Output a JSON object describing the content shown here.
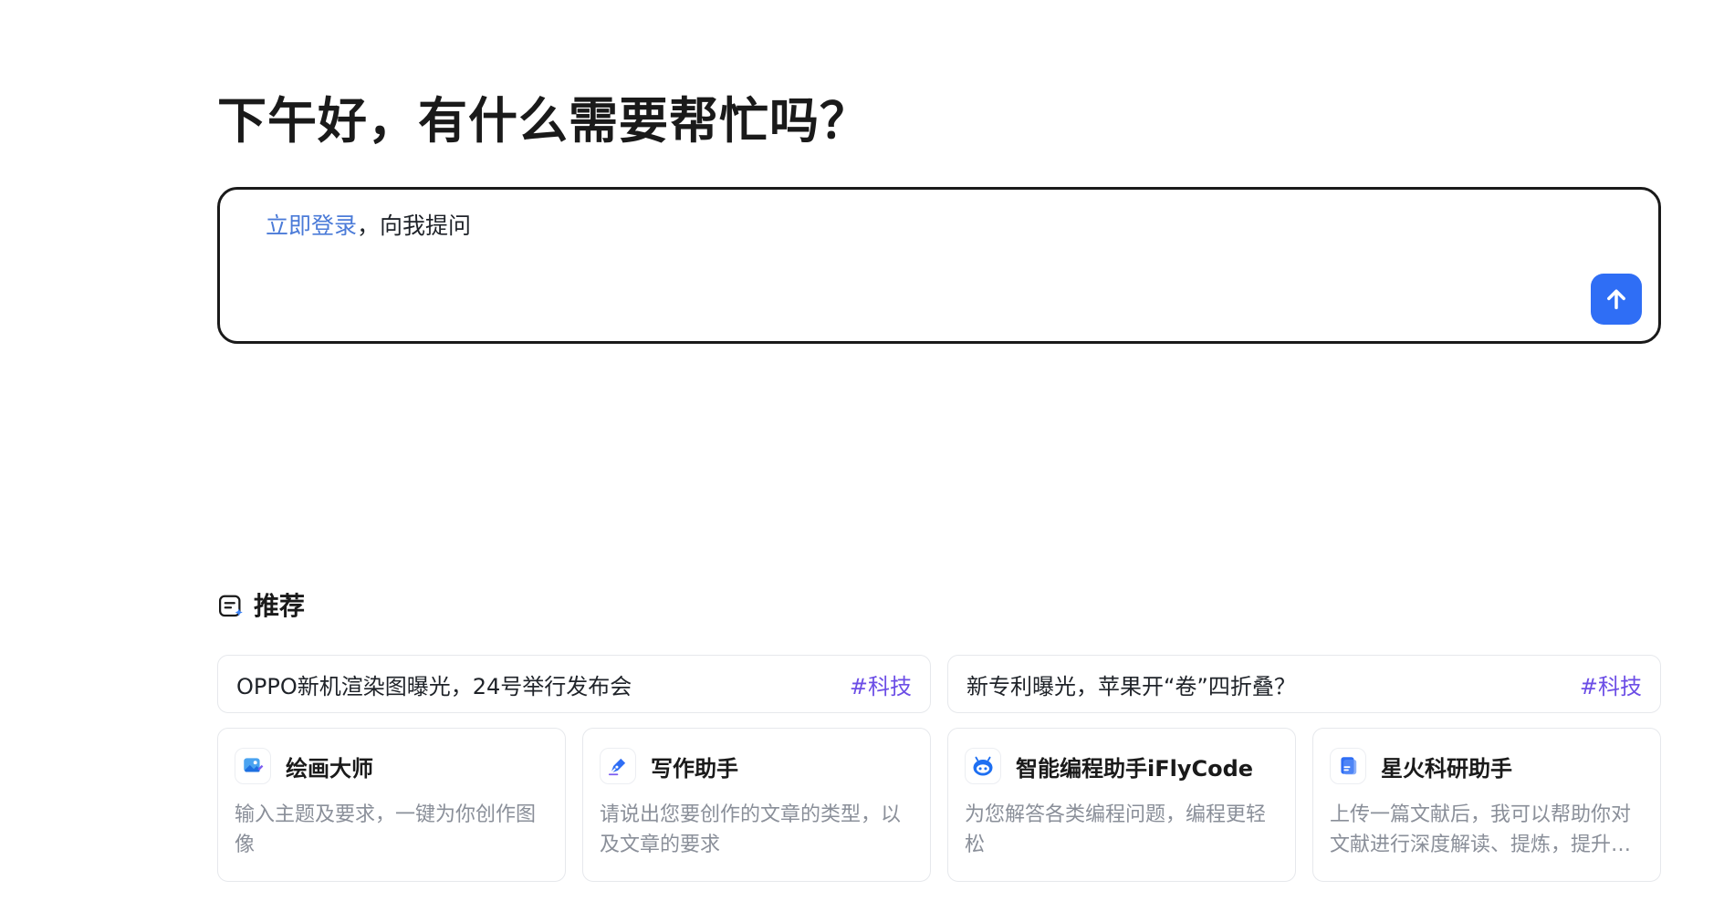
{
  "greeting": "下午好，有什么需要帮忙吗？",
  "input": {
    "login_link": "立即登录",
    "prompt_suffix": "，向我提问",
    "send_icon": "arrow-up-icon"
  },
  "recommend": {
    "title": "推荐",
    "icon": "recommend-icon",
    "news": [
      {
        "text": "OPPO新机渲染图曝光，24号举行发布会",
        "tag": "#科技"
      },
      {
        "text": "新专利曝光，苹果开“卷”四折叠？",
        "tag": "#科技"
      }
    ],
    "apps": [
      {
        "title": "绘画大师",
        "desc": "输入主题及要求，一键为你创作图像",
        "icon": "painting-icon"
      },
      {
        "title": "写作助手",
        "desc": "请说出您要创作的文章的类型，以及文章的要求",
        "icon": "pen-icon"
      },
      {
        "title": "智能编程助手iFlyCode",
        "desc": "为您解答各类编程问题，编程更轻松",
        "icon": "robot-icon"
      },
      {
        "title": "星火科研助手",
        "desc": "上传一篇文献后，我可以帮助你对文献进行深度解读、提炼，提升科研...",
        "icon": "document-icon"
      }
    ]
  },
  "colors": {
    "accent": "#2f6ef5",
    "link": "#4b7bd8",
    "tag": "#6c4ee6"
  }
}
